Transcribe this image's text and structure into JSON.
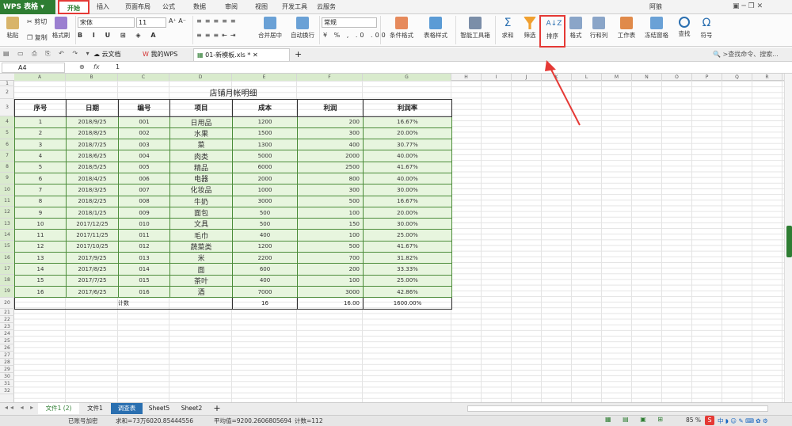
{
  "app": {
    "logo": "WPS 表格",
    "user": "阿狼"
  },
  "menu": [
    "开始",
    "插入",
    "页面布局",
    "公式",
    "数据",
    "审阅",
    "视图",
    "开发工具",
    "云服务"
  ],
  "ribbon": {
    "paste": "粘贴",
    "cut": "剪切",
    "copy": "复制",
    "format_painter": "格式刷",
    "font": "宋体",
    "size": "11",
    "number_format": "常规",
    "merge": "合并居中",
    "wrap": "自动换行",
    "cond_format": "条件格式",
    "table_style": "表格样式",
    "smart_tools": "智能工具箱",
    "sum": "求和",
    "filter": "筛选",
    "sort": "排序",
    "format": "格式",
    "rowcol": "行和列",
    "worksheet": "工作表",
    "freeze": "冻结窗格",
    "find": "查找",
    "symbol": "符号"
  },
  "doc_tabs": {
    "cloud": "云文档",
    "mywps": "我的WPS",
    "file": "01-新模板.xls *",
    "search": "查找命令、搜索..."
  },
  "formula": {
    "cell": "A4",
    "fx": "fx",
    "value": "1"
  },
  "columns": [
    "A",
    "B",
    "C",
    "D",
    "E",
    "F",
    "G",
    "H",
    "I",
    "J",
    "K",
    "L",
    "M",
    "N",
    "O",
    "P",
    "Q",
    "R"
  ],
  "table": {
    "title": "店铺月帐明细",
    "headers": [
      "序号",
      "日期",
      "编号",
      "项目",
      "成本",
      "利润",
      "利润率"
    ],
    "rows": [
      [
        "1",
        "2018/9/25",
        "001",
        "日用品",
        "1200",
        "200",
        "16.67%"
      ],
      [
        "2",
        "2018/8/25",
        "002",
        "水果",
        "1500",
        "300",
        "20.00%"
      ],
      [
        "3",
        "2018/7/25",
        "003",
        "菜",
        "1300",
        "400",
        "30.77%"
      ],
      [
        "4",
        "2018/6/25",
        "004",
        "肉类",
        "5000",
        "2000",
        "40.00%"
      ],
      [
        "5",
        "2018/5/25",
        "005",
        "精品",
        "6000",
        "2500",
        "41.67%"
      ],
      [
        "6",
        "2018/4/25",
        "006",
        "电器",
        "2000",
        "800",
        "40.00%"
      ],
      [
        "7",
        "2018/3/25",
        "007",
        "化妆品",
        "1000",
        "300",
        "30.00%"
      ],
      [
        "8",
        "2018/2/25",
        "008",
        "牛奶",
        "3000",
        "500",
        "16.67%"
      ],
      [
        "9",
        "2018/1/25",
        "009",
        "面包",
        "500",
        "100",
        "20.00%"
      ],
      [
        "10",
        "2017/12/25",
        "010",
        "文具",
        "500",
        "150",
        "30.00%"
      ],
      [
        "11",
        "2017/11/25",
        "011",
        "毛巾",
        "400",
        "100",
        "25.00%"
      ],
      [
        "12",
        "2017/10/25",
        "012",
        "蔬菜类",
        "1200",
        "500",
        "41.67%"
      ],
      [
        "13",
        "2017/9/25",
        "013",
        "米",
        "2200",
        "700",
        "31.82%"
      ],
      [
        "14",
        "2017/8/25",
        "014",
        "面",
        "600",
        "200",
        "33.33%"
      ],
      [
        "15",
        "2017/7/25",
        "015",
        "茶叶",
        "400",
        "100",
        "25.00%"
      ],
      [
        "16",
        "2017/6/25",
        "016",
        "酒",
        "7000",
        "3000",
        "42.86%"
      ]
    ],
    "count_label": "计数",
    "count_cost": "16",
    "count_profit": "16.00",
    "count_rate": "1600.00%"
  },
  "sheets": [
    "文件1 (2)",
    "文件1",
    "调查表",
    "Sheet5",
    "Sheet2"
  ],
  "status": {
    "left": "已账号加密",
    "sum": "求和=73万6020.85444556",
    "avg": "平均值=9200.2606805694",
    "count": "计数=112",
    "zoom": "85 %"
  },
  "colors": {
    "accent": "#2e7d32",
    "highlight": "#e53935",
    "fill": "#e7f5de"
  }
}
